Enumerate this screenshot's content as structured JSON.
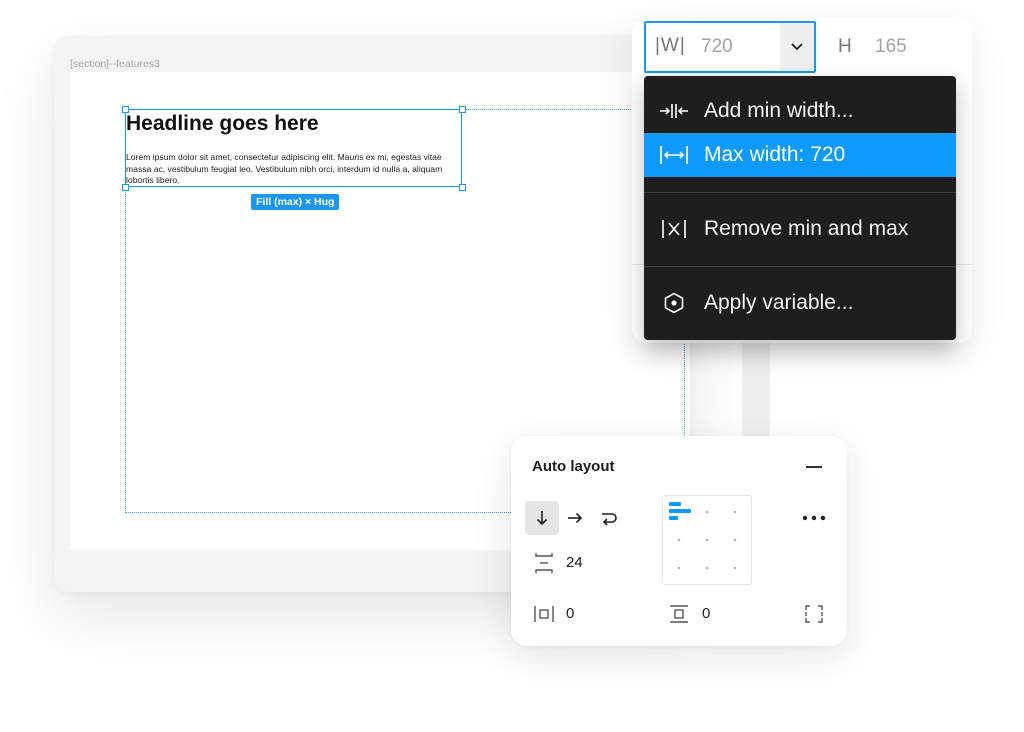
{
  "canvas": {
    "section_label": "[section]--features3",
    "headline": "Headline goes here",
    "body_text": "Lorem ipsum dolor sit amet, consectetur adipiscing elit. Mauris ex mi, egestas vitae massa ac, vestibulum feugiat leo. Vestibulum nibh orci, interdum id nulla a, aliquam lobortis libero.",
    "size_tag": "Fill (max) × Hug"
  },
  "properties": {
    "width_label": "|W|",
    "width_value": "720",
    "height_label": "H",
    "height_value": "165"
  },
  "menu": {
    "items": [
      {
        "label": "Add min width...",
        "icon": "add-min-width-icon",
        "selected": false
      },
      {
        "label": "Max width: 720",
        "icon": "max-width-icon",
        "selected": true
      },
      {
        "label": "Remove min and max",
        "icon": "remove-min-max-icon",
        "selected": false
      },
      {
        "label": "Apply variable...",
        "icon": "variable-hexagon-icon",
        "selected": false
      }
    ]
  },
  "auto_layout": {
    "title": "Auto layout",
    "gap": "24",
    "padding_horizontal": "0",
    "padding_vertical": "0",
    "direction": "vertical",
    "alignment": "top-left"
  },
  "colors": {
    "accent": "#0d99ff",
    "menu_bg": "#1e1e1e"
  }
}
